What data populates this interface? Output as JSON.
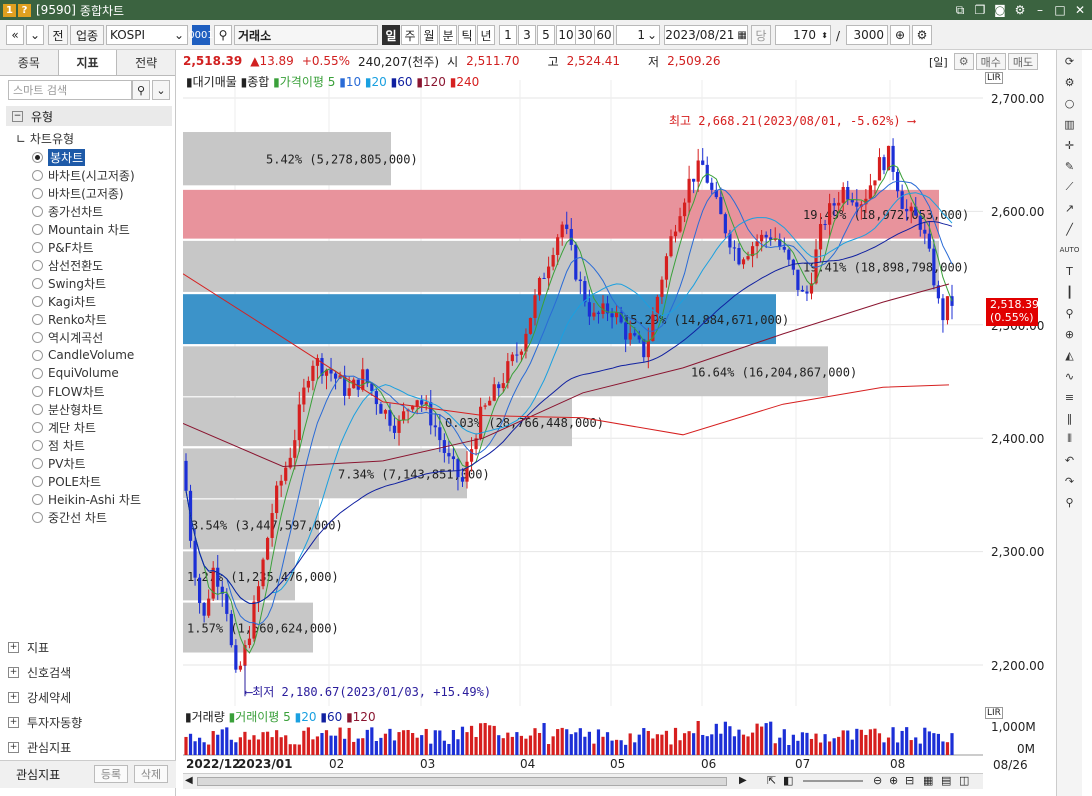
{
  "window": {
    "code": "[9590]",
    "title": "종합차트"
  },
  "toolbar": {
    "nav_prev": "«",
    "nav_menu": "»",
    "jeon": "전",
    "market_type": "업종",
    "market": "KOSPI",
    "market_code": "0001",
    "market_name": "거래소",
    "periods": [
      "일",
      "주",
      "월",
      "분",
      "틱",
      "년"
    ],
    "active_period": "일",
    "intervals": [
      "1",
      "3",
      "5",
      "10",
      "30",
      "60"
    ],
    "count_input": "1",
    "date": "2023/08/21",
    "unit_label": "당",
    "bars": "170",
    "max_bars": "3000"
  },
  "sidebar": {
    "tabs": [
      "종목",
      "지표",
      "전략"
    ],
    "active_tab": "지표",
    "search_placeholder": "스마트 검색",
    "section": "유형",
    "tree_root": "차트유형",
    "chart_types": [
      "봉차트",
      "바차트(시고저종)",
      "바차트(고저종)",
      "종가선차트",
      "Mountain 차트",
      "P&F차트",
      "삼선전환도",
      "Swing차트",
      "Kagi차트",
      "Renko차트",
      "역시계곡선",
      "CandleVolume",
      "EquiVolume",
      "FLOW차트",
      "분산형차트",
      "계단 차트",
      "점 차트",
      "PV차트",
      "POLE차트",
      "Heikin-Ashi 차트",
      "중간선 차트"
    ],
    "selected_type": "봉차트",
    "bottom_sections": [
      "지표",
      "신호검색",
      "강세약세",
      "투자자동향",
      "관심지표"
    ],
    "fav_label": "관심지표",
    "fav_register": "등록",
    "fav_delete": "삭제"
  },
  "price_info": {
    "price": "2,518.39",
    "change": "▲13.89",
    "change_pct": "+0.55%",
    "volume": "240,207(천주)",
    "open_label": "시",
    "open": "2,511.70",
    "high_label": "고",
    "high": "2,524.41",
    "low_label": "저",
    "low": "2,509.26"
  },
  "top_right": {
    "period": "[일]",
    "buy": "매수",
    "sell": "매도"
  },
  "legend": {
    "main": "대기매물",
    "combined": "종합",
    "ma_label": "가격이평 5",
    "ma": [
      "10",
      "20",
      "60",
      "120",
      "240"
    ]
  },
  "vol_legend": {
    "title": "거래량",
    "ma_label": "거래이평 5",
    "ma": [
      "20",
      "60",
      "120"
    ]
  },
  "y_axis": [
    "2,700.00",
    "2,600.00",
    "2,500.00",
    "2,400.00",
    "2,300.00",
    "2,200.00"
  ],
  "vol_axis": [
    "1,000M",
    "0M"
  ],
  "current_price_tag": {
    "price": "2,518.39",
    "pct": "(0.55%)"
  },
  "annotations": {
    "high": "최고 2,668.21(2023/08/01, -5.62%)",
    "low": "최저 2,180.67(2023/01/03, +15.49%)"
  },
  "supply_bands": [
    {
      "label": "5.42% (5,278,805,000)"
    },
    {
      "label": "19.49% (18,972,053,000)"
    },
    {
      "label": "19.41% (18,898,798,000)"
    },
    {
      "label": "15.29% (14,884,671,000)"
    },
    {
      "label": "16.64% (16,204,867,000)"
    },
    {
      "label": "0.03% (28,766,448,000)"
    },
    {
      "label": "7.34% (7,143,851,000)"
    },
    {
      "label": "3.54% (3,447,597,000)"
    },
    {
      "label": "1.27% (1,235,476,000)"
    },
    {
      "label": "1.57% (1,560,624,000)"
    }
  ],
  "x_axis": [
    "2022/12",
    "2023/01",
    "02",
    "03",
    "04",
    "05",
    "06",
    "07",
    "08"
  ],
  "x_end": "08/26",
  "colors": {
    "up": "#d61f1f",
    "down": "#1c2fd6",
    "band_gray": "#c7c7c7",
    "band_red": "#e8939c",
    "band_blue": "#3c93c9",
    "ma5": "#3aa03a",
    "ma10": "#2a6bd6",
    "ma20": "#1aa0e0",
    "ma60": "#1020a0",
    "ma120": "#8a1530",
    "ma240": "#d62020"
  }
}
